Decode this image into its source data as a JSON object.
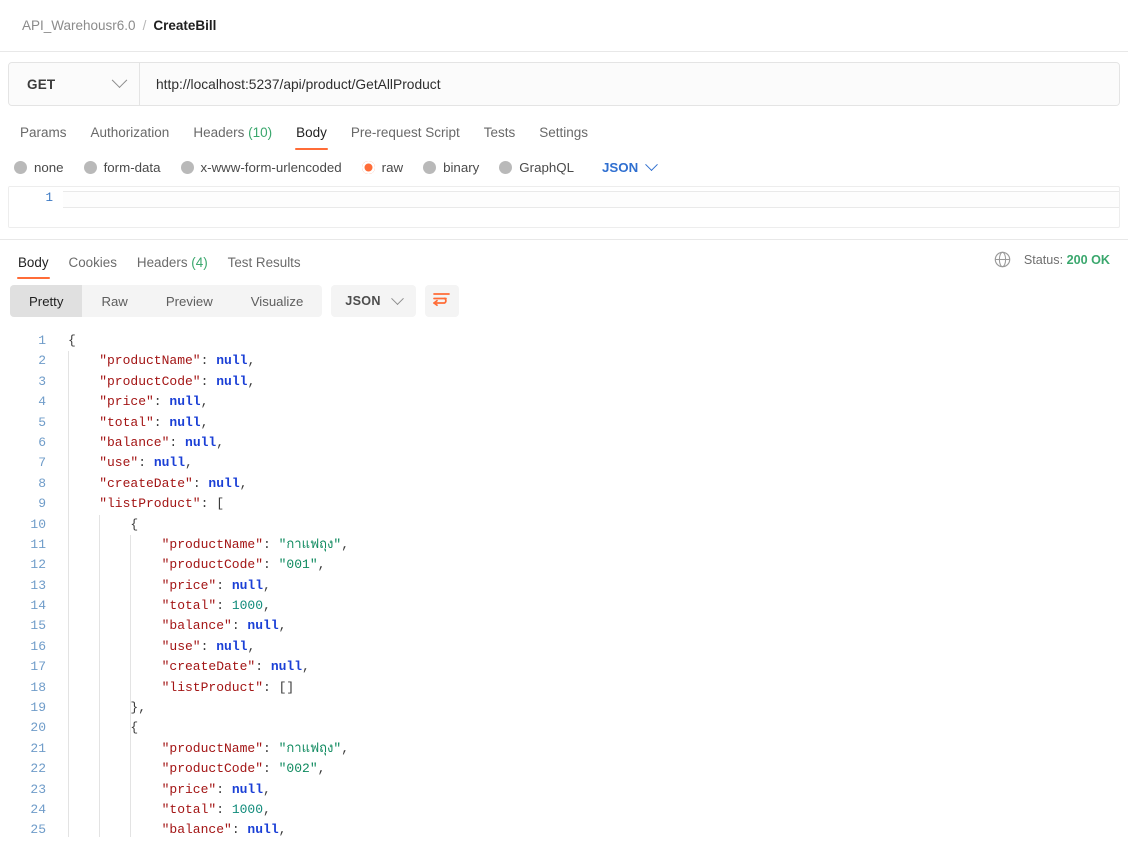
{
  "breadcrumb": {
    "collection": "API_Warehousr6.0",
    "separator": "/",
    "current": "CreateBill"
  },
  "request": {
    "method": "GET",
    "url": "http://localhost:5237/api/product/GetAllProduct",
    "tabs": [
      {
        "label": "Params",
        "active": false
      },
      {
        "label": "Authorization",
        "active": false
      },
      {
        "label": "Headers",
        "count": "(10)",
        "active": false
      },
      {
        "label": "Body",
        "active": true
      },
      {
        "label": "Pre-request Script",
        "active": false
      },
      {
        "label": "Tests",
        "active": false
      },
      {
        "label": "Settings",
        "active": false
      }
    ],
    "body_types": [
      {
        "label": "none",
        "selected": false
      },
      {
        "label": "form-data",
        "selected": false
      },
      {
        "label": "x-www-form-urlencoded",
        "selected": false
      },
      {
        "label": "raw",
        "selected": true
      },
      {
        "label": "binary",
        "selected": false
      },
      {
        "label": "GraphQL",
        "selected": false
      }
    ],
    "raw_format": "JSON",
    "editor": {
      "line_number": "1",
      "content": ""
    }
  },
  "response": {
    "tabs": [
      {
        "label": "Body",
        "active": true
      },
      {
        "label": "Cookies",
        "active": false
      },
      {
        "label": "Headers",
        "count": "(4)",
        "active": false
      },
      {
        "label": "Test Results",
        "active": false
      }
    ],
    "status_label": "Status:",
    "status_value": "200 OK",
    "globe_icon": "globe-icon",
    "view_modes": [
      {
        "label": "Pretty",
        "active": true
      },
      {
        "label": "Raw",
        "active": false
      },
      {
        "label": "Preview",
        "active": false
      },
      {
        "label": "Visualize",
        "active": false
      }
    ],
    "format": "JSON",
    "wrap_icon": "wrap-text-icon",
    "json_lines": [
      {
        "n": "1",
        "indent": 0,
        "tokens": [
          {
            "t": "brc",
            "v": "{"
          }
        ]
      },
      {
        "n": "2",
        "indent": 1,
        "tokens": [
          {
            "t": "k",
            "v": "\"productName\""
          },
          {
            "t": "p",
            "v": ": "
          },
          {
            "t": "nul",
            "v": "null"
          },
          {
            "t": "p",
            "v": ","
          }
        ]
      },
      {
        "n": "3",
        "indent": 1,
        "tokens": [
          {
            "t": "k",
            "v": "\"productCode\""
          },
          {
            "t": "p",
            "v": ": "
          },
          {
            "t": "nul",
            "v": "null"
          },
          {
            "t": "p",
            "v": ","
          }
        ]
      },
      {
        "n": "4",
        "indent": 1,
        "tokens": [
          {
            "t": "k",
            "v": "\"price\""
          },
          {
            "t": "p",
            "v": ": "
          },
          {
            "t": "nul",
            "v": "null"
          },
          {
            "t": "p",
            "v": ","
          }
        ]
      },
      {
        "n": "5",
        "indent": 1,
        "tokens": [
          {
            "t": "k",
            "v": "\"total\""
          },
          {
            "t": "p",
            "v": ": "
          },
          {
            "t": "nul",
            "v": "null"
          },
          {
            "t": "p",
            "v": ","
          }
        ]
      },
      {
        "n": "6",
        "indent": 1,
        "tokens": [
          {
            "t": "k",
            "v": "\"balance\""
          },
          {
            "t": "p",
            "v": ": "
          },
          {
            "t": "nul",
            "v": "null"
          },
          {
            "t": "p",
            "v": ","
          }
        ]
      },
      {
        "n": "7",
        "indent": 1,
        "tokens": [
          {
            "t": "k",
            "v": "\"use\""
          },
          {
            "t": "p",
            "v": ": "
          },
          {
            "t": "nul",
            "v": "null"
          },
          {
            "t": "p",
            "v": ","
          }
        ]
      },
      {
        "n": "8",
        "indent": 1,
        "tokens": [
          {
            "t": "k",
            "v": "\"createDate\""
          },
          {
            "t": "p",
            "v": ": "
          },
          {
            "t": "nul",
            "v": "null"
          },
          {
            "t": "p",
            "v": ","
          }
        ]
      },
      {
        "n": "9",
        "indent": 1,
        "tokens": [
          {
            "t": "k",
            "v": "\"listProduct\""
          },
          {
            "t": "p",
            "v": ": "
          },
          {
            "t": "brc",
            "v": "["
          }
        ]
      },
      {
        "n": "10",
        "indent": 2,
        "tokens": [
          {
            "t": "brc",
            "v": "{"
          }
        ]
      },
      {
        "n": "11",
        "indent": 3,
        "tokens": [
          {
            "t": "k",
            "v": "\"productName\""
          },
          {
            "t": "p",
            "v": ": "
          },
          {
            "t": "str",
            "v": "\"กาแฟถุง\""
          },
          {
            "t": "p",
            "v": ","
          }
        ]
      },
      {
        "n": "12",
        "indent": 3,
        "tokens": [
          {
            "t": "k",
            "v": "\"productCode\""
          },
          {
            "t": "p",
            "v": ": "
          },
          {
            "t": "str",
            "v": "\"001\""
          },
          {
            "t": "p",
            "v": ","
          }
        ]
      },
      {
        "n": "13",
        "indent": 3,
        "tokens": [
          {
            "t": "k",
            "v": "\"price\""
          },
          {
            "t": "p",
            "v": ": "
          },
          {
            "t": "nul",
            "v": "null"
          },
          {
            "t": "p",
            "v": ","
          }
        ]
      },
      {
        "n": "14",
        "indent": 3,
        "tokens": [
          {
            "t": "k",
            "v": "\"total\""
          },
          {
            "t": "p",
            "v": ": "
          },
          {
            "t": "num",
            "v": "1000"
          },
          {
            "t": "p",
            "v": ","
          }
        ]
      },
      {
        "n": "15",
        "indent": 3,
        "tokens": [
          {
            "t": "k",
            "v": "\"balance\""
          },
          {
            "t": "p",
            "v": ": "
          },
          {
            "t": "nul",
            "v": "null"
          },
          {
            "t": "p",
            "v": ","
          }
        ]
      },
      {
        "n": "16",
        "indent": 3,
        "tokens": [
          {
            "t": "k",
            "v": "\"use\""
          },
          {
            "t": "p",
            "v": ": "
          },
          {
            "t": "nul",
            "v": "null"
          },
          {
            "t": "p",
            "v": ","
          }
        ]
      },
      {
        "n": "17",
        "indent": 3,
        "tokens": [
          {
            "t": "k",
            "v": "\"createDate\""
          },
          {
            "t": "p",
            "v": ": "
          },
          {
            "t": "nul",
            "v": "null"
          },
          {
            "t": "p",
            "v": ","
          }
        ]
      },
      {
        "n": "18",
        "indent": 3,
        "tokens": [
          {
            "t": "k",
            "v": "\"listProduct\""
          },
          {
            "t": "p",
            "v": ": "
          },
          {
            "t": "brc",
            "v": "[]"
          }
        ]
      },
      {
        "n": "19",
        "indent": 2,
        "tokens": [
          {
            "t": "brc",
            "v": "},"
          }
        ]
      },
      {
        "n": "20",
        "indent": 2,
        "tokens": [
          {
            "t": "brc",
            "v": "{"
          }
        ]
      },
      {
        "n": "21",
        "indent": 3,
        "tokens": [
          {
            "t": "k",
            "v": "\"productName\""
          },
          {
            "t": "p",
            "v": ": "
          },
          {
            "t": "str",
            "v": "\"กาแฟถุง\""
          },
          {
            "t": "p",
            "v": ","
          }
        ]
      },
      {
        "n": "22",
        "indent": 3,
        "tokens": [
          {
            "t": "k",
            "v": "\"productCode\""
          },
          {
            "t": "p",
            "v": ": "
          },
          {
            "t": "str",
            "v": "\"002\""
          },
          {
            "t": "p",
            "v": ","
          }
        ]
      },
      {
        "n": "23",
        "indent": 3,
        "tokens": [
          {
            "t": "k",
            "v": "\"price\""
          },
          {
            "t": "p",
            "v": ": "
          },
          {
            "t": "nul",
            "v": "null"
          },
          {
            "t": "p",
            "v": ","
          }
        ]
      },
      {
        "n": "24",
        "indent": 3,
        "tokens": [
          {
            "t": "k",
            "v": "\"total\""
          },
          {
            "t": "p",
            "v": ": "
          },
          {
            "t": "num",
            "v": "1000"
          },
          {
            "t": "p",
            "v": ","
          }
        ]
      },
      {
        "n": "25",
        "indent": 3,
        "tokens": [
          {
            "t": "k",
            "v": "\"balance\""
          },
          {
            "t": "p",
            "v": ": "
          },
          {
            "t": "nul",
            "v": "null"
          },
          {
            "t": "p",
            "v": ","
          }
        ]
      }
    ]
  },
  "colors": {
    "accent": "#ff6c37",
    "status_green": "#3aa76d",
    "json_blue": "#2f6fd0",
    "key_red": "#a31515",
    "null_blue": "#1a3fd6",
    "string_green": "#0f8a5f"
  }
}
